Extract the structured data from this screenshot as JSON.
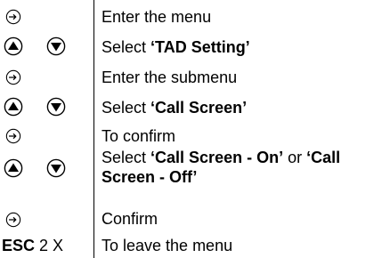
{
  "instructions": [
    {
      "keys": [
        "enter-icon"
      ],
      "text": "Enter the menu"
    },
    {
      "keys": [
        "up-icon",
        "down-icon"
      ],
      "text_before": "Select ",
      "highlight": "‘TAD Setting’"
    },
    {
      "keys": [
        "enter-icon"
      ],
      "text": "Enter the submenu"
    },
    {
      "keys": [
        "up-icon",
        "down-icon"
      ],
      "text_before": "Select ",
      "highlight": "‘Call Screen’"
    },
    {
      "keys": [
        "enter-icon"
      ],
      "text": "To confirm"
    },
    {
      "keys": [
        "up-icon",
        "down-icon"
      ],
      "text_before": "Select ",
      "highlight": "‘Call Screen - On’",
      "text_middle": " or ",
      "highlight2": "‘Call Screen - Off’"
    },
    {
      "keys": [
        "enter-icon"
      ],
      "text": "Confirm"
    },
    {
      "keys_text": {
        "key": "ESC",
        "repeat": "2 X"
      },
      "text": "To leave the menu"
    }
  ]
}
